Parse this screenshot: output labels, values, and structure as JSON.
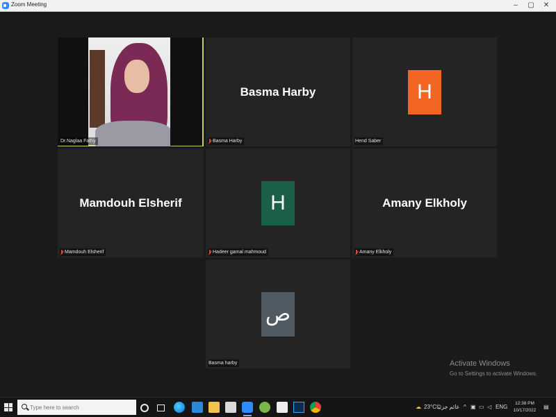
{
  "window": {
    "title": "Zoom Meeting",
    "controls": [
      "–",
      "▢",
      "✕"
    ]
  },
  "participants": [
    {
      "id": "p1",
      "display": "video",
      "label": "Dr.Naglaa Fathy",
      "muted": false,
      "active": true
    },
    {
      "id": "p2",
      "display": "name",
      "big_text": "Basma Harby",
      "label": "Basma Harby",
      "muted": true
    },
    {
      "id": "p3",
      "display": "avatar",
      "avatar_letter": "H",
      "avatar_color": "#f26522",
      "label": "Hend Saber",
      "muted": false
    },
    {
      "id": "p4",
      "display": "name",
      "big_text": "Mamdouh Elsherif",
      "label": "Mamdouh Elsherif",
      "muted": true
    },
    {
      "id": "p5",
      "display": "avatar",
      "avatar_letter": "H",
      "avatar_color": "#1b5e4a",
      "label": "Hadeer gamal mahmoud",
      "muted": true
    },
    {
      "id": "p6",
      "display": "name",
      "big_text": "Amany Elkholy",
      "label": "Amany Elkholy",
      "muted": true
    },
    {
      "id": "p7",
      "display": "avatar",
      "avatar_letter": "ص",
      "avatar_color": "#4f5a63",
      "label": "Basma harby",
      "muted": false
    }
  ],
  "watermark": {
    "line1": "Activate Windows",
    "line2": "Go to Settings to activate Windows."
  },
  "taskbar": {
    "search_placeholder": "Type here to search",
    "weather": "23°C",
    "weather_text": "غائم جزئيًا",
    "time": "12:38 PM",
    "date": "10/17/2022"
  },
  "colors": {
    "active_speaker_border": "#c3d06a",
    "tile_bg": "#242424",
    "stage_bg": "#1a1a1a"
  }
}
